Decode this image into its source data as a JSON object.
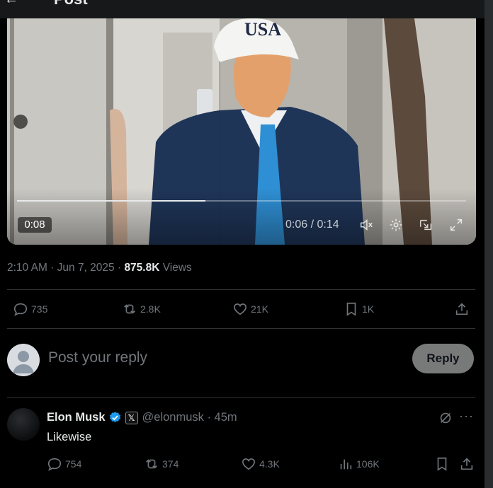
{
  "header": {
    "back_glyph": "←",
    "title": "Post"
  },
  "video": {
    "elapsed_badge": "0:08",
    "time_display": "0:06 / 0:14",
    "progress": 0.42,
    "hat_text": "USA"
  },
  "post_meta": {
    "time": "2:10 AM · Jun 7, 2025 · ",
    "views_count": "875.8K",
    "views_label": " Views"
  },
  "actions": {
    "replies": "735",
    "reposts": "2.8K",
    "likes": "21K",
    "bookmarks": "1K"
  },
  "reply_box": {
    "placeholder": "Post your reply",
    "button_label": "Reply"
  },
  "comment": {
    "name": "Elon Musk",
    "x_badge": "𝕏",
    "handle_time": "@elonmusk · 45m",
    "text": "Likewise",
    "more": "···",
    "replies": "754",
    "reposts": "374",
    "likes": "4.3K",
    "views": "106K"
  },
  "colors": {
    "background": "#000000",
    "muted": "#71767b",
    "text": "#e7e9ea",
    "verified": "#1d9bf0",
    "divider": "#2f3336"
  }
}
